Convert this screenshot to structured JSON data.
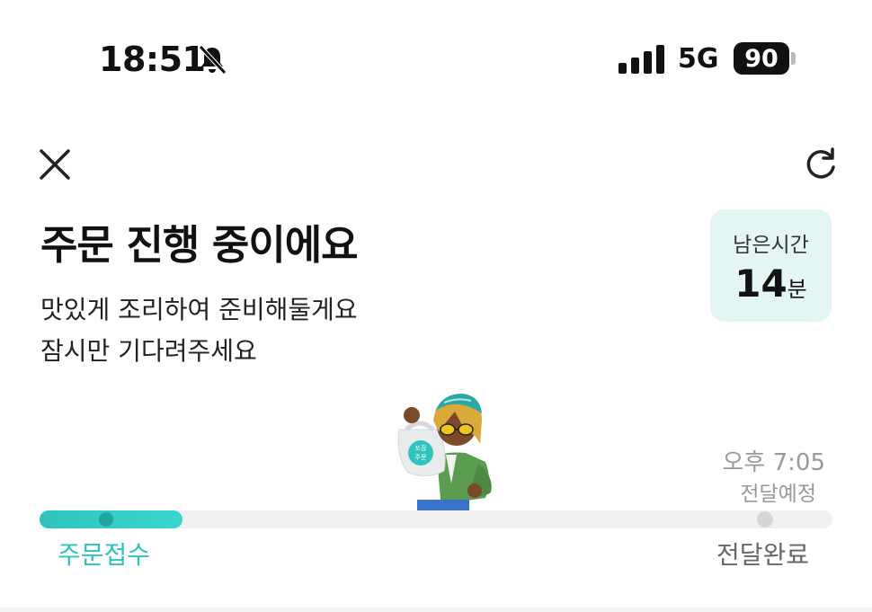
{
  "status_bar": {
    "time": "18:51",
    "network": "5G",
    "battery": "90",
    "icons": [
      "bell-muted-icon",
      "signal-icon"
    ]
  },
  "header": {
    "close_icon": "close-icon",
    "refresh_icon": "refresh-icon"
  },
  "order": {
    "title": "주문 진행 중이에요",
    "subtitle_lines": [
      "맛있게 조리하여 준비해둘게요",
      "잠시만 기다려주세요"
    ]
  },
  "remaining": {
    "label": "남은시간",
    "value": "14",
    "unit": "분"
  },
  "eta": {
    "time": "오후 7:05",
    "label": "전달예정"
  },
  "progress": {
    "fraction": 0.18,
    "steps": [
      {
        "label": "주문접수",
        "state": "done"
      },
      {
        "label": "전달완료",
        "state": "pending"
      }
    ]
  },
  "illustration": {
    "bag_text": [
      "포장",
      "주문"
    ]
  },
  "colors": {
    "accent": "#2ec4bb",
    "card_bg": "#e3f6f4",
    "muted_text": "#999999"
  }
}
